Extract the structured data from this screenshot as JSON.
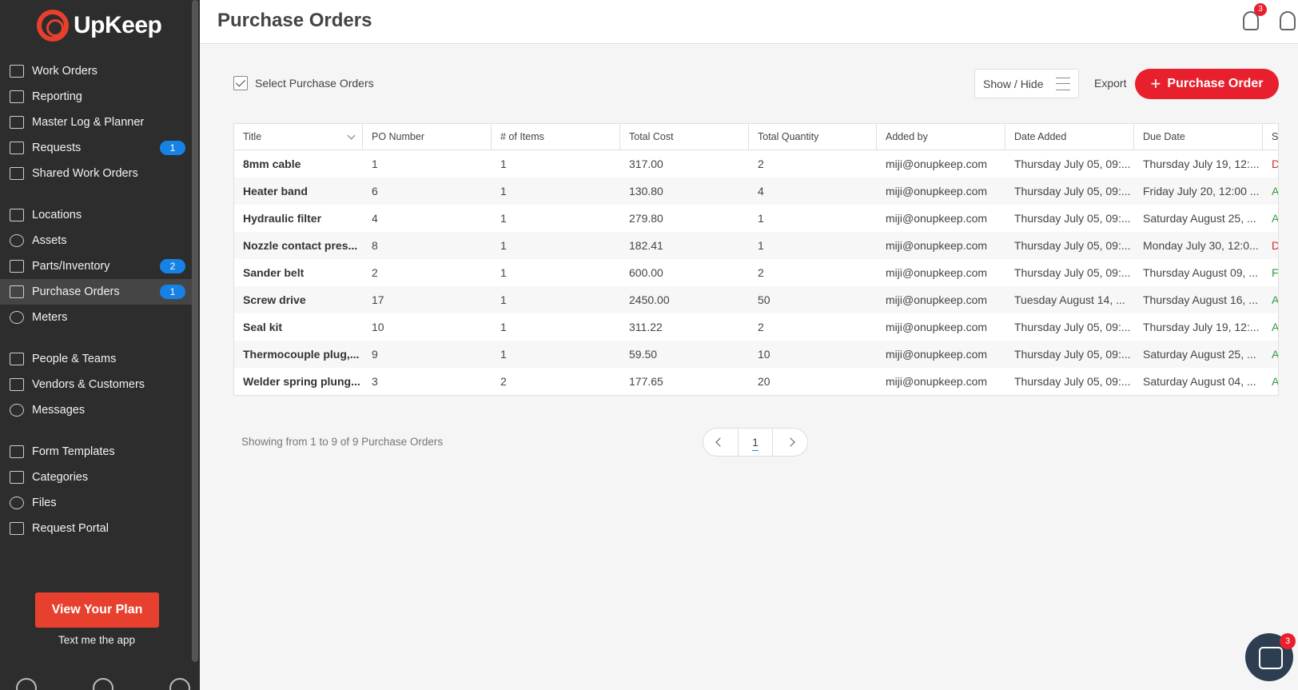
{
  "app": {
    "brand": "UpKeep"
  },
  "header": {
    "title": "Purchase Orders",
    "ideas_badge": "3"
  },
  "sidebar": {
    "items": [
      {
        "label": "Work Orders",
        "icon": "clipboard-icon"
      },
      {
        "label": "Reporting",
        "icon": "chart-icon"
      },
      {
        "label": "Master Log & Planner",
        "icon": "book-icon"
      },
      {
        "label": "Requests",
        "icon": "inbox-icon",
        "badge": "1"
      },
      {
        "label": "Shared Work Orders",
        "icon": "share-icon"
      },
      {
        "label": "Locations",
        "icon": "map-icon"
      },
      {
        "label": "Assets",
        "icon": "cube-icon"
      },
      {
        "label": "Parts/Inventory",
        "icon": "wrench-icon",
        "badge": "2"
      },
      {
        "label": "Purchase Orders",
        "icon": "document-icon",
        "badge": "1",
        "active": true
      },
      {
        "label": "Meters",
        "icon": "gauge-icon"
      },
      {
        "label": "People & Teams",
        "icon": "people-icon"
      },
      {
        "label": "Vendors & Customers",
        "icon": "vendors-icon"
      },
      {
        "label": "Messages",
        "icon": "chat-icon"
      },
      {
        "label": "Form Templates",
        "icon": "form-icon"
      },
      {
        "label": "Categories",
        "icon": "bookmark-icon"
      },
      {
        "label": "Files",
        "icon": "cloud-icon"
      },
      {
        "label": "Request Portal",
        "icon": "portal-icon"
      }
    ],
    "plan_button": "View Your Plan",
    "text_app": "Text me the app"
  },
  "toolbar": {
    "select_label": "Select Purchase Orders",
    "show_hide_label": "Show / Hide",
    "export_label": "Export",
    "add_label": "Purchase Order"
  },
  "table": {
    "columns": [
      "Title",
      "PO Number",
      "# of Items",
      "Total Cost",
      "Total Quantity",
      "Added by",
      "Date Added",
      "Due Date",
      "S"
    ],
    "rows": [
      [
        "8mm cable",
        "1",
        "1",
        "317.00",
        "2",
        "miji@onupkeep.com",
        "Thursday July 05, 09:...",
        "Thursday July 19, 12:...",
        "D"
      ],
      [
        "Heater band",
        "6",
        "1",
        "130.80",
        "4",
        "miji@onupkeep.com",
        "Thursday July 05, 09:...",
        "Friday July 20, 12:00 ...",
        "A"
      ],
      [
        "Hydraulic filter",
        "4",
        "1",
        "279.80",
        "1",
        "miji@onupkeep.com",
        "Thursday July 05, 09:...",
        "Saturday August 25, ...",
        "A"
      ],
      [
        "Nozzle contact pres...",
        "8",
        "1",
        "182.41",
        "1",
        "miji@onupkeep.com",
        "Thursday July 05, 09:...",
        "Monday July 30, 12:0...",
        "D"
      ],
      [
        "Sander belt",
        "2",
        "1",
        "600.00",
        "2",
        "miji@onupkeep.com",
        "Thursday July 05, 09:...",
        "Thursday August 09, ...",
        "F"
      ],
      [
        "Screw drive",
        "17",
        "1",
        "2450.00",
        "50",
        "miji@onupkeep.com",
        "Tuesday August 14, ...",
        "Thursday August 16, ...",
        "A"
      ],
      [
        "Seal kit",
        "10",
        "1",
        "311.22",
        "2",
        "miji@onupkeep.com",
        "Thursday July 05, 09:...",
        "Thursday July 19, 12:...",
        "A"
      ],
      [
        "Thermocouple plug,...",
        "9",
        "1",
        "59.50",
        "10",
        "miji@onupkeep.com",
        "Thursday July 05, 09:...",
        "Saturday August 25, ...",
        "A"
      ],
      [
        "Welder spring plung...",
        "3",
        "2",
        "177.65",
        "20",
        "miji@onupkeep.com",
        "Thursday July 05, 09:...",
        "Saturday August 04, ...",
        "A"
      ]
    ]
  },
  "footer": {
    "showing": "Showing from 1 to 9 of 9 Purchase Orders",
    "page": "1"
  },
  "chat": {
    "badge": "3"
  },
  "colors": {
    "accent": "#e8202e",
    "sidebar": "#2d2d2d",
    "badge_blue": "#1682e6"
  }
}
